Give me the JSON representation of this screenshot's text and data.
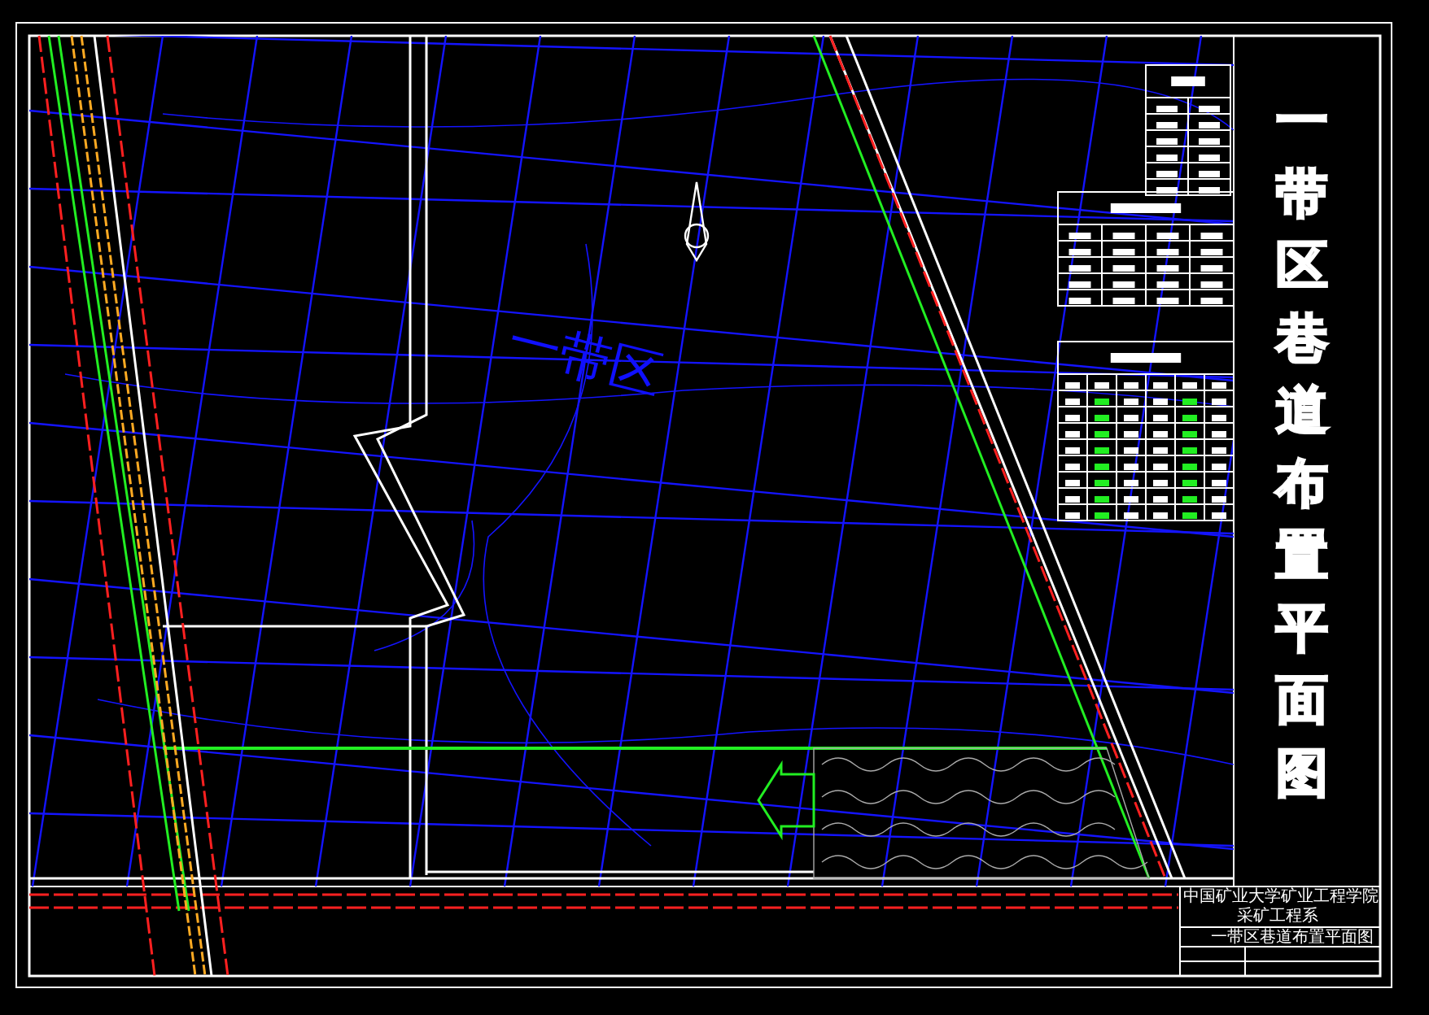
{
  "drawing_title": "一带区巷道布置平面图",
  "area_label": "一带区",
  "title_block": {
    "school": "中国矿业大学矿业工程学院",
    "department": "采矿工程系",
    "sheet_title": "一带区巷道布置平面图"
  }
}
